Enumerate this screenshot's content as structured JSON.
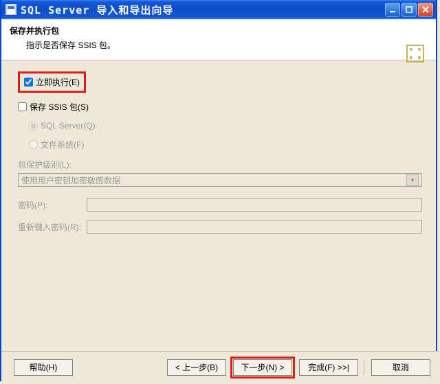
{
  "titlebar": {
    "title": "SQL Server 导入和导出向导"
  },
  "header": {
    "title": "保存并执行包",
    "subtitle": "指示是否保存 SSIS 包。"
  },
  "options": {
    "run_now": "立即执行(E)",
    "save_ssis": "保存 SSIS 包(S)",
    "sql_server": "SQL Server(Q)",
    "file_system": "文件系统(F)"
  },
  "protection": {
    "label": "包保护级别(L):",
    "value": "使用用户密钥加密敏感数据",
    "password_label": "密码(P):",
    "reenter_label": "重新键入密码(R):",
    "password_value": "",
    "reenter_value": ""
  },
  "buttons": {
    "help": "帮助(H)",
    "back": "< 上一步(B)",
    "next": "下一步(N) >",
    "finish": "完成(F) >>|",
    "cancel": "取消"
  }
}
